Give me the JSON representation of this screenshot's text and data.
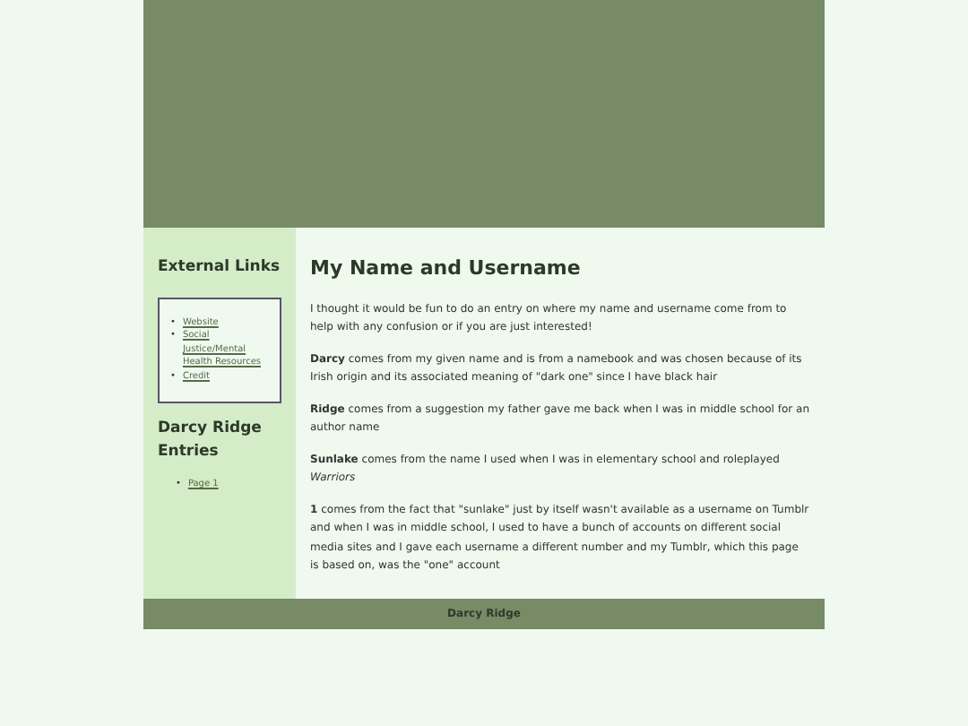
{
  "sidebar": {
    "links_title": "External Links",
    "links": [
      {
        "bullet": "•",
        "label": "Website"
      },
      {
        "bullet": "•",
        "label": "Social Justice/Mental Health Resources"
      },
      {
        "bullet": "•",
        "label": "Credit"
      }
    ],
    "entries_title": "Darcy Ridge Entries",
    "entries": [
      {
        "bullet": "•",
        "label": "Page 1"
      }
    ]
  },
  "main": {
    "title": "My Name and Username",
    "paragraphs": [
      "I thought it would be fun to do an entry on where my name and username come from to help with any confusion or if you are just interested!",
      "**Darcy** comes from my given name and is from a namebook and was chosen because of its Irish origin and its associated meaning of \"dark one\" since I have black hair",
      "**Ridge** comes from a suggestion my father gave me back when I was in middle school for an author name",
      "**Sunlake** comes from the name I used when I was in elementary school and roleplayed *Warriors*",
      "**1** comes from the fact that \"sunlake\" just by itself wasn't available as a username on Tumblr and when I was in middle school, I used to have a bunch of accounts on different social media sites and I gave each username a different number and my Tumblr, which this page is based on, was the \"one\" account"
    ]
  },
  "footer": "Darcy Ridge"
}
